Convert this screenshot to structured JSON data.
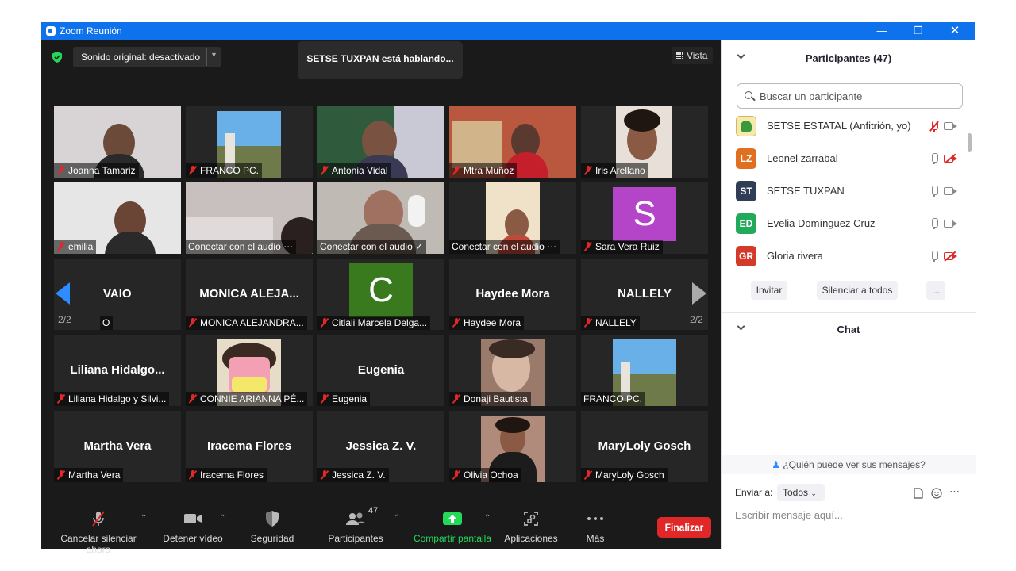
{
  "window": {
    "title": "Zoom Reunión"
  },
  "meeting": {
    "audio_dropdown": "Sonido original: desactivado",
    "speaking": "SETSE TUXPAN está hablando...",
    "view_label": "Vista",
    "page_left": "2/2",
    "page_right": "2/2",
    "tiles": [
      {
        "name": "Joanna Tamariz",
        "big": "",
        "kind": "video"
      },
      {
        "name": "FRANCO PC.",
        "big": "",
        "kind": "video"
      },
      {
        "name": "Antonia Vidal",
        "big": "",
        "kind": "video"
      },
      {
        "name": "Mtra Muñoz",
        "big": "",
        "kind": "video"
      },
      {
        "name": "Iris Arellano",
        "big": "",
        "kind": "video"
      },
      {
        "name": "emilia",
        "big": "",
        "kind": "video"
      },
      {
        "name": "Conectar con el audio ⋯",
        "big": "",
        "kind": "video"
      },
      {
        "name": "Conectar con el audio ✓",
        "big": "",
        "kind": "video"
      },
      {
        "name": "Conectar con el audio ⋯",
        "big": "",
        "kind": "video"
      },
      {
        "name": "Sara Vera Ruiz",
        "big": "S",
        "kind": "avatar"
      },
      {
        "name": "O",
        "big": "VAIO",
        "kind": "name"
      },
      {
        "name": "MONICA ALEJANDRA...",
        "big": "MONICA  ALEJA...",
        "kind": "name"
      },
      {
        "name": "Citlali Marcela Delga...",
        "big": "C",
        "kind": "avatar"
      },
      {
        "name": "Haydee Mora",
        "big": "Haydee Mora",
        "kind": "name"
      },
      {
        "name": "NALLELY",
        "big": "NALLELY",
        "kind": "name"
      },
      {
        "name": "Liliana Hidalgo y Silvi...",
        "big": "Liliana  Hidalgo...",
        "kind": "name"
      },
      {
        "name": "CONNIE ARIANNA PÉ...",
        "big": "",
        "kind": "video"
      },
      {
        "name": "Eugenia",
        "big": "Eugenia",
        "kind": "name"
      },
      {
        "name": "Donaji Bautista",
        "big": "",
        "kind": "video"
      },
      {
        "name": "FRANCO PC.",
        "big": "",
        "kind": "video"
      },
      {
        "name": "Martha Vera",
        "big": "Martha Vera",
        "kind": "name"
      },
      {
        "name": "Iracema Flores",
        "big": "Iracema Flores",
        "kind": "name"
      },
      {
        "name": "Jessica Z. V.",
        "big": "Jessica Z. V.",
        "kind": "name"
      },
      {
        "name": "Olivia Ochoa",
        "big": "",
        "kind": "video"
      },
      {
        "name": "MaryLoly Gosch",
        "big": "MaryLoly Gosch",
        "kind": "name"
      }
    ]
  },
  "controls": {
    "unmute": "Cancelar silenciar ahora",
    "stop_video": "Detener vídeo",
    "security": "Seguridad",
    "participants": "Participantes",
    "participants_count": "47",
    "share": "Compartir pantalla",
    "apps": "Aplicaciones",
    "more": "Más",
    "end": "Finalizar"
  },
  "sidebar": {
    "participants_title": "Participantes (47)",
    "search_placeholder": "Buscar un participante",
    "participants": [
      {
        "initials": "",
        "name": "SETSE ESTATAL (Anfitrión, yo)",
        "color": "#f5e8b0",
        "mic": "muted",
        "cam": "on"
      },
      {
        "initials": "LZ",
        "name": "Leonel zarrabal",
        "color": "#e07020",
        "mic": "on",
        "cam": "off"
      },
      {
        "initials": "ST",
        "name": "SETSE TUXPAN",
        "color": "#2f3d55",
        "mic": "on",
        "cam": "on"
      },
      {
        "initials": "ED",
        "name": "Evelia Domínguez Cruz",
        "color": "#22a95a",
        "mic": "on",
        "cam": "on"
      },
      {
        "initials": "GR",
        "name": "Gloria rivera",
        "color": "#d43a2a",
        "mic": "on",
        "cam": "off"
      }
    ],
    "invite": "Invitar",
    "mute_all": "Silenciar a todos",
    "more": "...",
    "chat_title": "Chat",
    "who_can_see": "¿Quién puede ver sus mensajes?",
    "send_to_label": "Enviar a:",
    "send_to_value": "Todos",
    "message_placeholder": "Escribir mensaje aquí..."
  }
}
